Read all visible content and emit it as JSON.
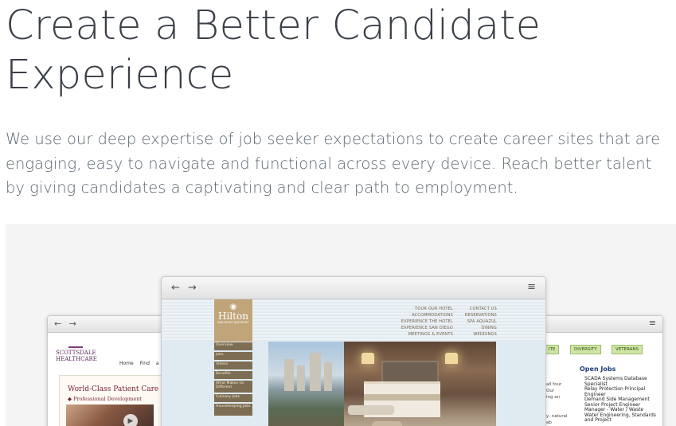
{
  "header": {
    "title": "Create a Better Candidate Experience",
    "body": "We use our deep expertise of job seeker expectations to create career sites that are engaging, easy to navigate and functional across every device. Reach better talent by giving candidates a captivating and clear path to employment."
  },
  "showcase": {
    "browser_controls": {
      "nav": "← →",
      "menu": "≡"
    },
    "left_site": {
      "logo_line1": "SCOTTSDALE",
      "logo_line2": "HEALTHCARE",
      "nav": "Home  Find a Doc",
      "hero_title": "World-Class Patient Care",
      "hero_sub": "◆ Professional Development",
      "play": "▶"
    },
    "center_site": {
      "logo_name": "Hilton",
      "logo_sub": "SAN DIEGO BAYFRONT",
      "nav_col1": [
        "TOUR OUR HOTEL",
        "ACCOMMODATIONS",
        "EXPERIENCE THE HOTEL",
        "EXPERIENCE SAN DIEGO",
        "MEETINGS & EVENTS"
      ],
      "nav_col2": [
        "CONTACT US",
        "RESERVATIONS",
        "SPA AQUAZUL",
        "DINING",
        "WEDDINGS"
      ],
      "sidebar": [
        "Overview",
        "Jobs",
        "Videos",
        "Benefits",
        "What Makes Us Different",
        "Culinary Jobs",
        "Housekeeping Jobs"
      ]
    },
    "right_site": {
      "tabs": [
        "ITE",
        "DIVERSITY",
        "VETERANS"
      ],
      "open_jobs_heading": "Open Jobs",
      "side_text": [
        "all four",
        "Our",
        "ing an",
        "",
        "",
        "y, natural",
        "ab"
      ],
      "jobs": [
        "SCADA Systems Database Specialist",
        "Relay Protection Principal Engineer",
        "Demand Side Management Senior Project Engineer",
        "Manager - Water / Waste Water Engineering, Standards and Project"
      ]
    }
  }
}
